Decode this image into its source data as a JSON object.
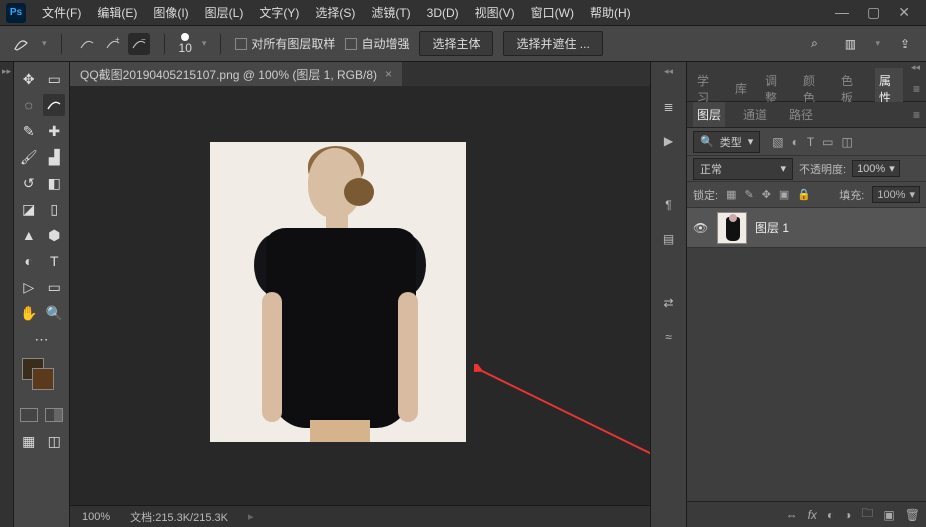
{
  "menu": [
    "文件(F)",
    "编辑(E)",
    "图像(I)",
    "图层(L)",
    "文字(Y)",
    "选择(S)",
    "滤镜(T)",
    "3D(D)",
    "视图(V)",
    "窗口(W)",
    "帮助(H)"
  ],
  "options": {
    "brush_size": "10",
    "sample_all": "对所有图层取样",
    "auto_enhance": "自动增强",
    "select_subject": "选择主体",
    "select_and_mask": "选择并遮住 ..."
  },
  "document": {
    "tab_title": "QQ截图20190405215107.png @ 100% (图层 1, RGB/8)",
    "zoom": "100%",
    "doc_info": "文档:215.3K/215.3K"
  },
  "panel_tabs_top": {
    "learn": "学习",
    "lib": "库",
    "adjust": "调整",
    "color": "颜色",
    "swatch": "色板",
    "props": "属性"
  },
  "layers_panel": {
    "tab_layers": "图层",
    "tab_channels": "通道",
    "tab_paths": "路径",
    "filter_label": "类型",
    "blend_mode": "正常",
    "opacity_label": "不透明度:",
    "opacity_value": "100%",
    "lock_label": "锁定:",
    "fill_label": "填充:",
    "fill_value": "100%",
    "layer1_name": "图层 1"
  },
  "icons": {
    "search": "⌕"
  }
}
